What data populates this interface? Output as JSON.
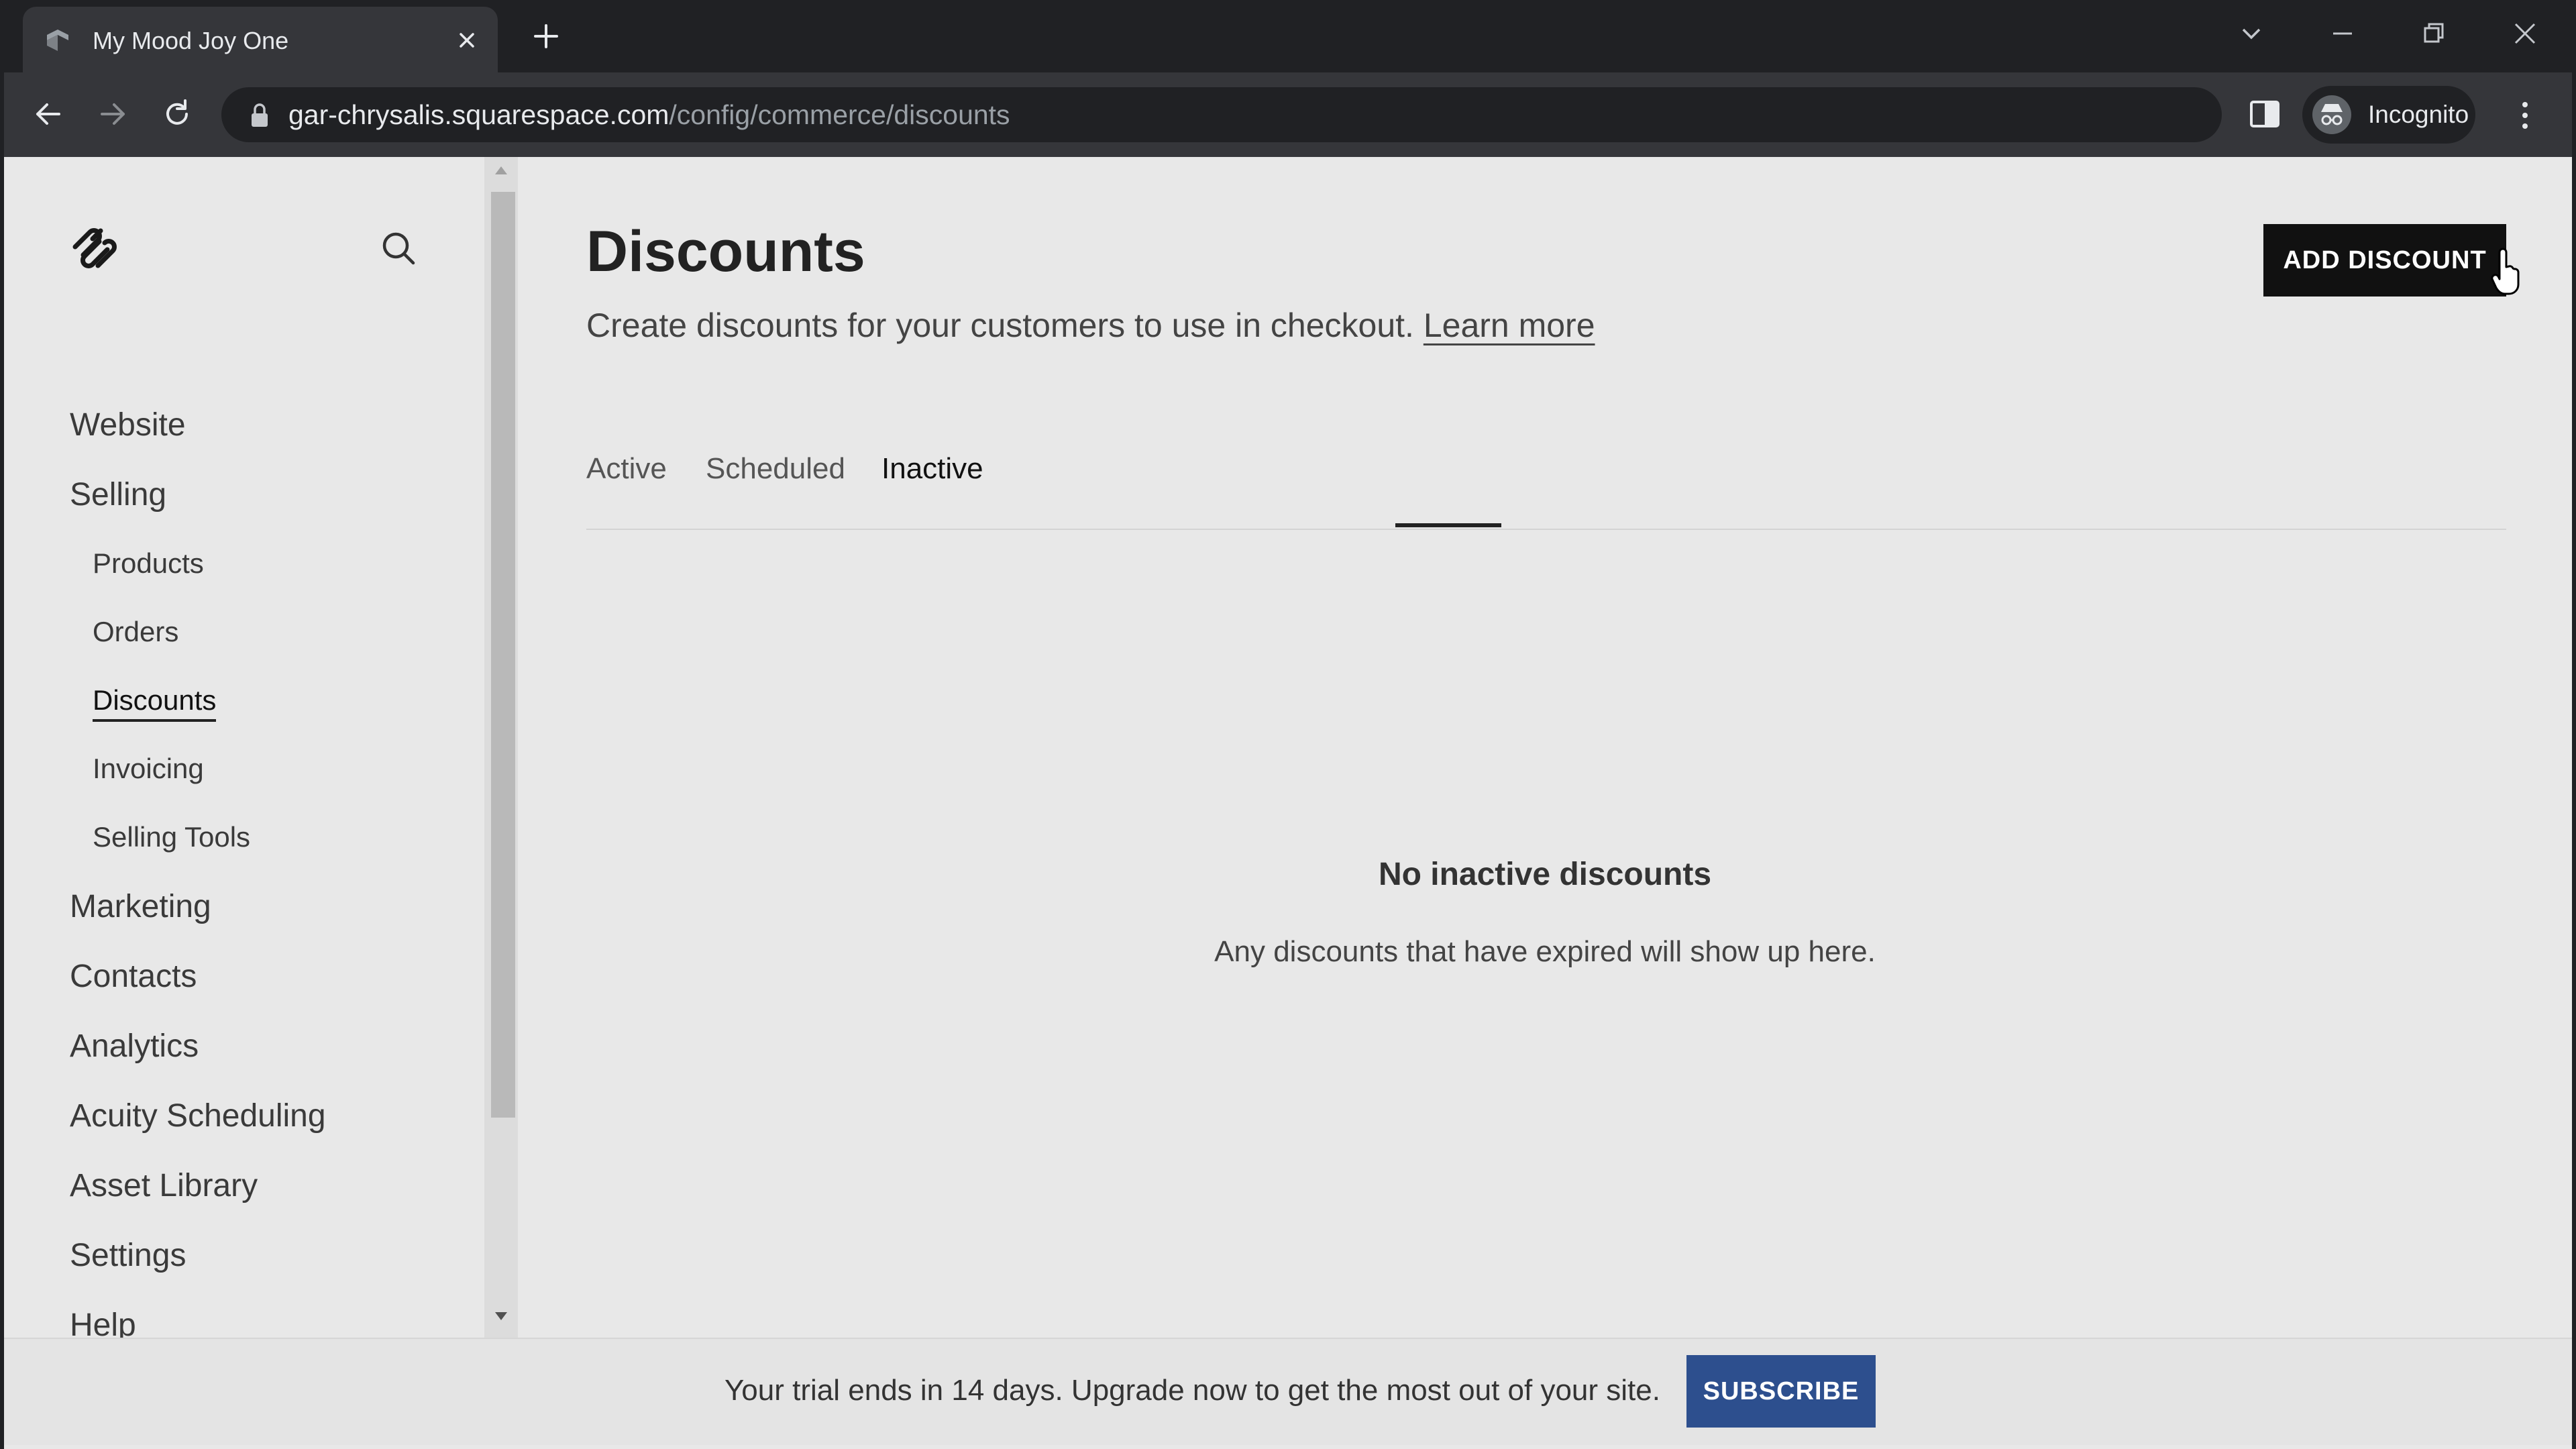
{
  "browser": {
    "tab_title": "My Mood Joy One",
    "url_host": "gar-chrysalis.squarespace.com",
    "url_path": "/config/commerce/discounts",
    "profile_label": "Incognito"
  },
  "sidebar": {
    "items": [
      {
        "label": "Website"
      },
      {
        "label": "Selling"
      },
      {
        "label": "Products"
      },
      {
        "label": "Orders"
      },
      {
        "label": "Discounts"
      },
      {
        "label": "Invoicing"
      },
      {
        "label": "Selling Tools"
      },
      {
        "label": "Marketing"
      },
      {
        "label": "Contacts"
      },
      {
        "label": "Analytics"
      },
      {
        "label": "Acuity Scheduling"
      },
      {
        "label": "Asset Library"
      },
      {
        "label": "Settings"
      },
      {
        "label": "Help"
      }
    ]
  },
  "main": {
    "title": "Discounts",
    "subtitle": "Create discounts for your customers to use in checkout.",
    "learn_more": "Learn more",
    "add_button": "ADD DISCOUNT",
    "tabs": [
      {
        "label": "Active"
      },
      {
        "label": "Scheduled"
      },
      {
        "label": "Inactive"
      }
    ],
    "active_tab": "Inactive",
    "empty_title": "No inactive discounts",
    "empty_text": "Any discounts that have expired will show up here."
  },
  "trial": {
    "text": "Your trial ends in 14 days. Upgrade now to get the most out of your site.",
    "subscribe": "SUBSCRIBE"
  },
  "colors": {
    "chrome_dark": "#202124",
    "chrome_toolbar": "#35363a",
    "page_bg": "#e8e8e8",
    "button_dark": "#111111",
    "subscribe_blue": "#2d4f8e"
  }
}
